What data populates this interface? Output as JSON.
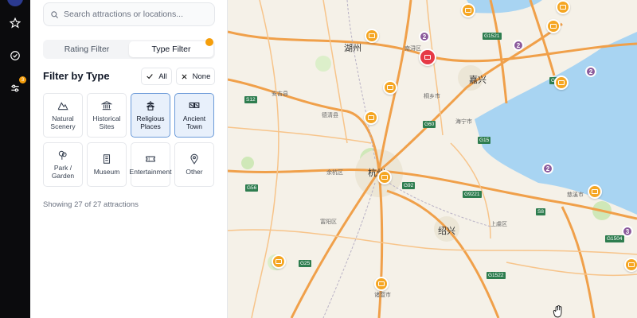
{
  "rail": {
    "items": [
      {
        "icon": "star-icon"
      },
      {
        "icon": "check-circle-icon"
      },
      {
        "icon": "filter-sliders-icon",
        "badge": "3"
      }
    ]
  },
  "search": {
    "placeholder": "Search attractions or locations..."
  },
  "tabs": [
    {
      "label": "Rating Filter",
      "active": false
    },
    {
      "label": "Type Filter",
      "active": true
    }
  ],
  "filter": {
    "title": "Filter by Type",
    "all_label": "All",
    "none_label": "None",
    "types": [
      {
        "label": "Natural Scenery",
        "icon": "mountain-icon",
        "selected": false
      },
      {
        "label": "Historical Sites",
        "icon": "museum-building-icon",
        "selected": false
      },
      {
        "label": "Religious Places",
        "icon": "pagoda-icon",
        "selected": true
      },
      {
        "label": "Ancient Town",
        "icon": "ticket-town-icon",
        "selected": true
      },
      {
        "label": "Park / Garden",
        "icon": "tree-icon",
        "selected": false
      },
      {
        "label": "Museum",
        "icon": "building-icon",
        "selected": false
      },
      {
        "label": "Entertainment",
        "icon": "ticket-icon",
        "selected": false
      },
      {
        "label": "Other",
        "icon": "map-pin-icon",
        "selected": false
      }
    ],
    "status": "Showing 27 of 27 attractions"
  },
  "map": {
    "cities": [
      {
        "name": "湖州",
        "size": "big"
      },
      {
        "name": "嘉兴",
        "size": "big"
      },
      {
        "name": "杭州",
        "size": "big"
      },
      {
        "name": "绍兴",
        "size": "big"
      },
      {
        "name": "德清县",
        "size": "small"
      },
      {
        "name": "海宁市",
        "size": "small"
      },
      {
        "name": "余杭区",
        "size": "small"
      },
      {
        "name": "桐乡市",
        "size": "small"
      },
      {
        "name": "富阳区",
        "size": "small"
      },
      {
        "name": "诸暨市",
        "size": "small"
      },
      {
        "name": "上虞区",
        "size": "small"
      },
      {
        "name": "慈溪市",
        "size": "small"
      },
      {
        "name": "南浔区",
        "size": "small"
      },
      {
        "name": "安吉县",
        "size": "small"
      }
    ],
    "clusters": [
      "2",
      "2",
      "2",
      "2",
      "3"
    ],
    "highways": [
      "G1521",
      "G50",
      "S12",
      "G60",
      "G92",
      "G9221",
      "S8",
      "G1504",
      "G25",
      "G1522",
      "G56",
      "G15"
    ]
  }
}
